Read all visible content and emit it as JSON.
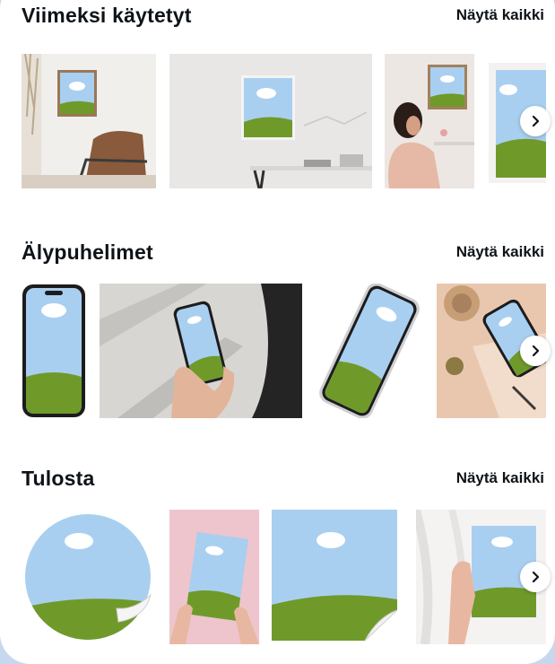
{
  "sections": [
    {
      "title": "Viimeksi käytetyt",
      "see_all": "Näytä kaikki"
    },
    {
      "title": "Älypuhelimet",
      "see_all": "Näytä kaikki"
    },
    {
      "title": "Tulosta",
      "see_all": "Näytä kaikki"
    }
  ],
  "icons": {
    "next": "chevron-right-icon"
  },
  "colors": {
    "sky": "#a9cff0",
    "grass": "#6f9a2a",
    "panel": "#ffffff",
    "background": "#c6d7ee"
  }
}
